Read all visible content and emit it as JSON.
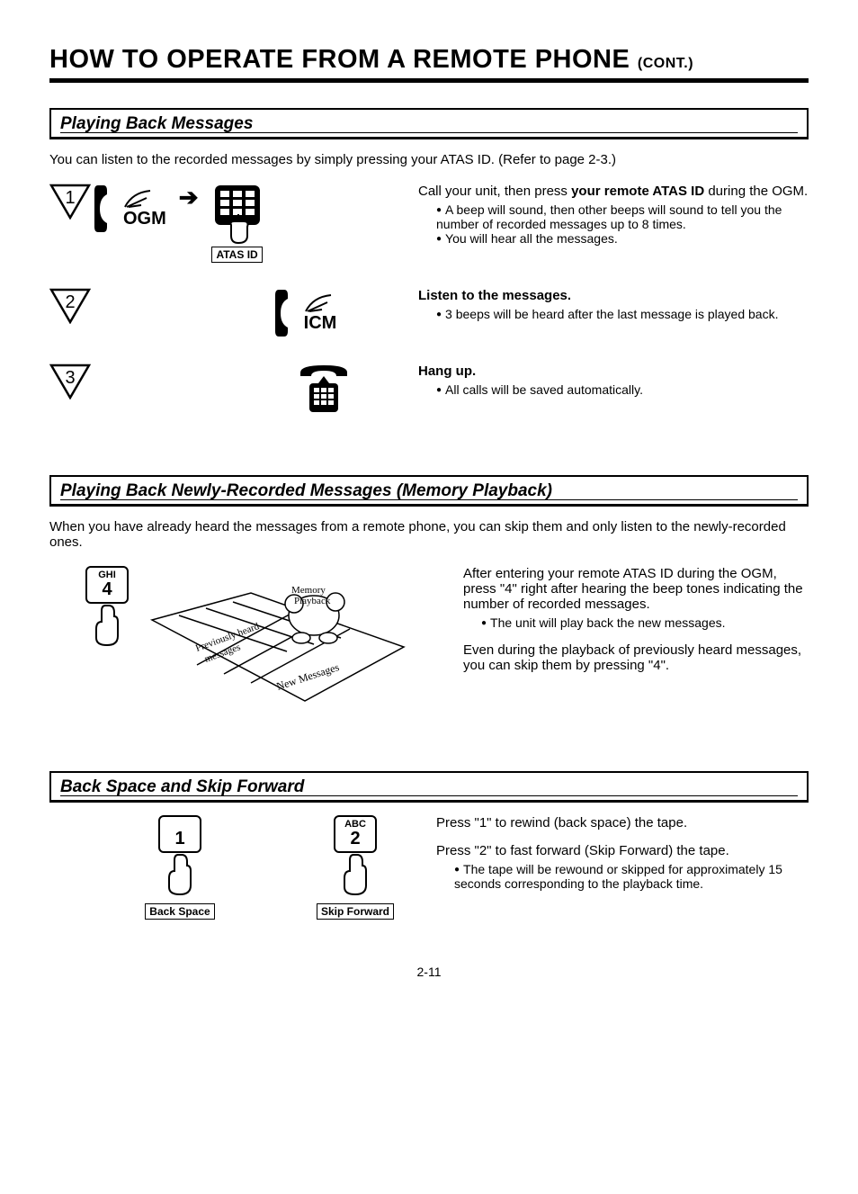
{
  "title_main": "HOW TO OPERATE FROM A REMOTE PHONE ",
  "title_cont": "(CONT.)",
  "sections": {
    "playback": {
      "heading": "Playing Back Messages",
      "intro": "You can listen to the recorded messages by simply pressing your ATAS ID. (Refer to page 2-3.)",
      "step1": {
        "lead_a": "Call your unit, then press ",
        "lead_b": "your remote ATAS ID",
        "lead_c": " during the OGM.",
        "b1": "A beep will sound, then other beeps will sound to tell you the number of recorded messages up to 8 times.",
        "b2": "You will hear all the messages.",
        "ogm": "OGM",
        "atas_id": "ATAS ID"
      },
      "step2": {
        "lead": "Listen to the messages.",
        "b1": "3 beeps will be heard after the last message is played back.",
        "icm": "ICM"
      },
      "step3": {
        "lead": "Hang up.",
        "b1": "All calls will be saved automatically."
      }
    },
    "memory": {
      "heading": "Playing Back Newly-Recorded Messages (Memory Playback)",
      "intro": "When you have already heard the messages from a remote phone, you can skip them and only listen to the newly-recorded ones.",
      "key_small": "GHI",
      "key_big": "4",
      "para1": "After entering your remote ATAS ID during the OGM, press \"4\" right after hearing the beep tones indicating the number of recorded messages.",
      "b1": "The unit will play back the new messages.",
      "para2": "Even during the playback of previously heard messages, you can skip them by pressing \"4\".",
      "art_prev": "Previously heard messages",
      "art_mem": "Memory Playback",
      "art_new": "New Messages"
    },
    "skip": {
      "heading": "Back Space and Skip Forward",
      "key1_big": "1",
      "key2_small": "ABC",
      "key2_big": "2",
      "label_back": "Back Space",
      "label_fwd": "Skip Forward",
      "p1": "Press \"1\" to rewind (back space) the tape.",
      "p2": "Press \"2\" to fast forward (Skip Forward) the tape.",
      "b1": "The tape will be rewound or skipped for approximately 15 seconds corresponding to the playback time."
    }
  },
  "page_number": "2-11"
}
